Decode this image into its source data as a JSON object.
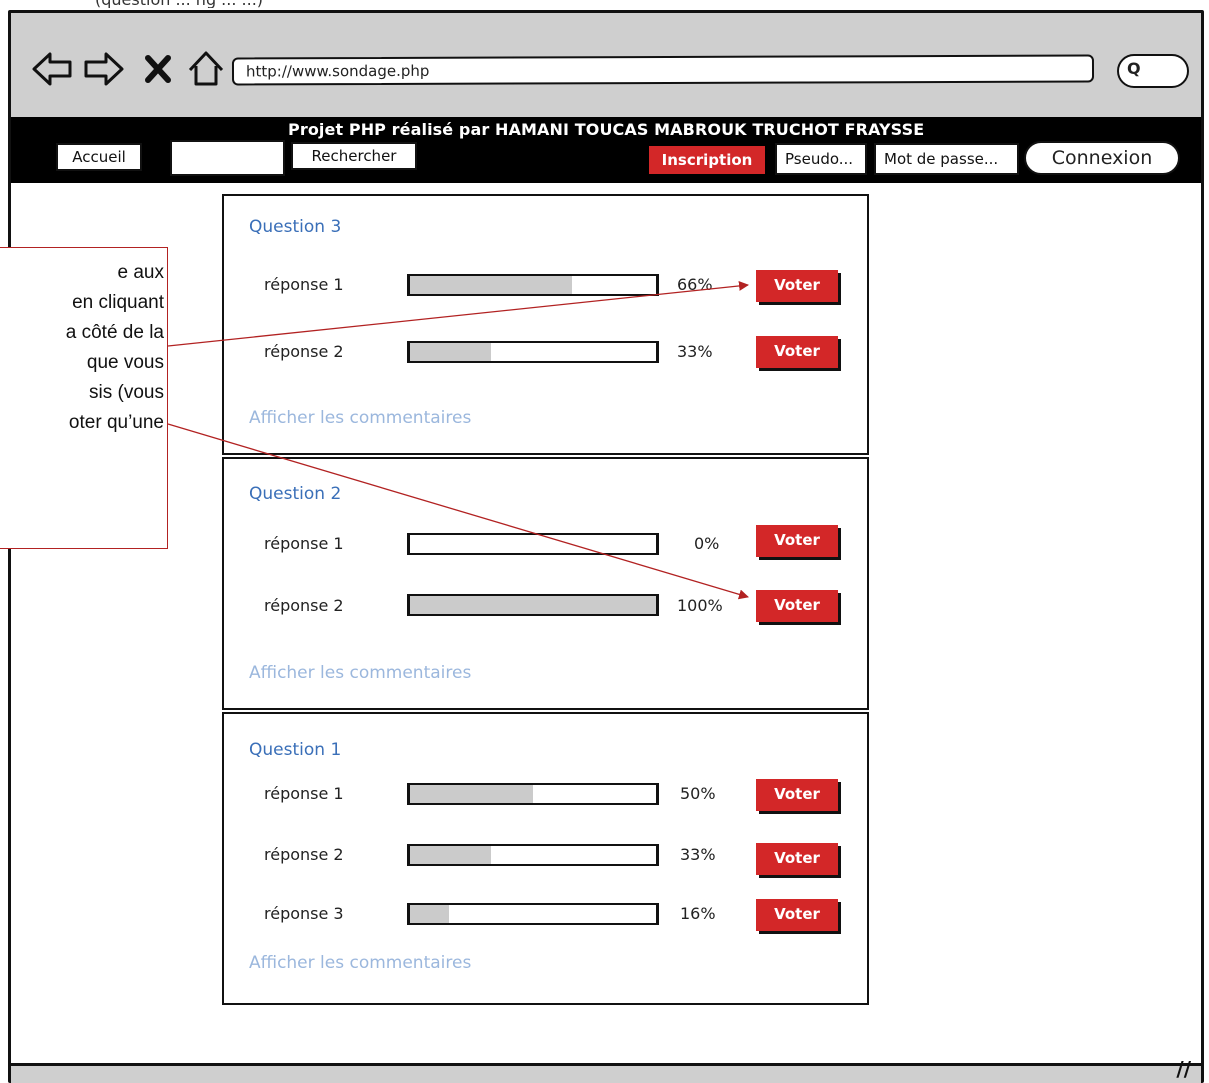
{
  "top_text": "(question ... ng ... ...)",
  "browser": {
    "url": "http://www.sondage.php",
    "nav_icons": [
      "back-arrow-icon",
      "forward-arrow-icon",
      "close-x-icon",
      "home-icon"
    ],
    "search_glyph": "Q"
  },
  "header": {
    "title": "Projet PHP réalisé par HAMANI TOUCAS MABROUK TRUCHOT FRAYSSE",
    "accueil": "Accueil",
    "search_value": "",
    "rechercher": "Rechercher",
    "inscription": "Inscription",
    "pseudo_placeholder": "Pseudo...",
    "password_placeholder": "Mot de passe...",
    "connexion": "Connexion"
  },
  "callout": {
    "text": "e aux\n en cliquant\na côté de la\nque vous\nsis (vous\noter qu’une"
  },
  "questions": [
    {
      "title": "Question 3",
      "answers": [
        {
          "label": "réponse 1",
          "percent": "66%",
          "fill": 0.66,
          "vote": "Voter"
        },
        {
          "label": "réponse 2",
          "percent": "33%",
          "fill": 0.33,
          "vote": "Voter"
        }
      ],
      "comments_link": "Afficher les commentaires"
    },
    {
      "title": "Question 2",
      "answers": [
        {
          "label": "réponse 1",
          "percent": "0%",
          "fill": 0.0,
          "vote": "Voter"
        },
        {
          "label": "réponse 2",
          "percent": "100%",
          "fill": 1.0,
          "vote": "Voter"
        }
      ],
      "comments_link": "Afficher les commentaires"
    },
    {
      "title": "Question 1",
      "answers": [
        {
          "label": "réponse 1",
          "percent": "50%",
          "fill": 0.5,
          "vote": "Voter"
        },
        {
          "label": "réponse 2",
          "percent": "33%",
          "fill": 0.33,
          "vote": "Voter"
        },
        {
          "label": "réponse 3",
          "percent": "16%",
          "fill": 0.16,
          "vote": "Voter"
        }
      ],
      "comments_link": "Afficher les commentaires"
    }
  ],
  "colors": {
    "vote": "#d32728",
    "question_title": "#3a6fb8",
    "comments_link": "#9bb7dd",
    "annotation": "#b22222"
  }
}
